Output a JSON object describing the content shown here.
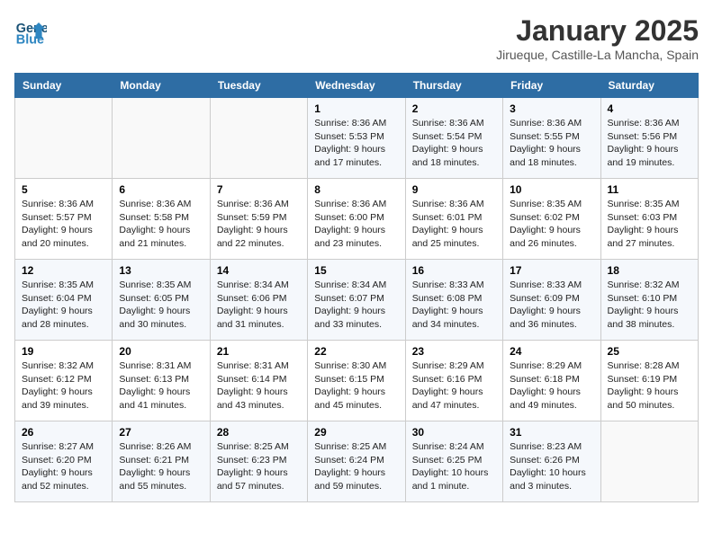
{
  "header": {
    "logo_line1": "General",
    "logo_line2": "Blue",
    "month_title": "January 2025",
    "location": "Jirueque, Castille-La Mancha, Spain"
  },
  "weekdays": [
    "Sunday",
    "Monday",
    "Tuesday",
    "Wednesday",
    "Thursday",
    "Friday",
    "Saturday"
  ],
  "weeks": [
    [
      {
        "day": "",
        "sunrise": "",
        "sunset": "",
        "daylight": ""
      },
      {
        "day": "",
        "sunrise": "",
        "sunset": "",
        "daylight": ""
      },
      {
        "day": "",
        "sunrise": "",
        "sunset": "",
        "daylight": ""
      },
      {
        "day": "1",
        "sunrise": "Sunrise: 8:36 AM",
        "sunset": "Sunset: 5:53 PM",
        "daylight": "Daylight: 9 hours and 17 minutes."
      },
      {
        "day": "2",
        "sunrise": "Sunrise: 8:36 AM",
        "sunset": "Sunset: 5:54 PM",
        "daylight": "Daylight: 9 hours and 18 minutes."
      },
      {
        "day": "3",
        "sunrise": "Sunrise: 8:36 AM",
        "sunset": "Sunset: 5:55 PM",
        "daylight": "Daylight: 9 hours and 18 minutes."
      },
      {
        "day": "4",
        "sunrise": "Sunrise: 8:36 AM",
        "sunset": "Sunset: 5:56 PM",
        "daylight": "Daylight: 9 hours and 19 minutes."
      }
    ],
    [
      {
        "day": "5",
        "sunrise": "Sunrise: 8:36 AM",
        "sunset": "Sunset: 5:57 PM",
        "daylight": "Daylight: 9 hours and 20 minutes."
      },
      {
        "day": "6",
        "sunrise": "Sunrise: 8:36 AM",
        "sunset": "Sunset: 5:58 PM",
        "daylight": "Daylight: 9 hours and 21 minutes."
      },
      {
        "day": "7",
        "sunrise": "Sunrise: 8:36 AM",
        "sunset": "Sunset: 5:59 PM",
        "daylight": "Daylight: 9 hours and 22 minutes."
      },
      {
        "day": "8",
        "sunrise": "Sunrise: 8:36 AM",
        "sunset": "Sunset: 6:00 PM",
        "daylight": "Daylight: 9 hours and 23 minutes."
      },
      {
        "day": "9",
        "sunrise": "Sunrise: 8:36 AM",
        "sunset": "Sunset: 6:01 PM",
        "daylight": "Daylight: 9 hours and 25 minutes."
      },
      {
        "day": "10",
        "sunrise": "Sunrise: 8:35 AM",
        "sunset": "Sunset: 6:02 PM",
        "daylight": "Daylight: 9 hours and 26 minutes."
      },
      {
        "day": "11",
        "sunrise": "Sunrise: 8:35 AM",
        "sunset": "Sunset: 6:03 PM",
        "daylight": "Daylight: 9 hours and 27 minutes."
      }
    ],
    [
      {
        "day": "12",
        "sunrise": "Sunrise: 8:35 AM",
        "sunset": "Sunset: 6:04 PM",
        "daylight": "Daylight: 9 hours and 28 minutes."
      },
      {
        "day": "13",
        "sunrise": "Sunrise: 8:35 AM",
        "sunset": "Sunset: 6:05 PM",
        "daylight": "Daylight: 9 hours and 30 minutes."
      },
      {
        "day": "14",
        "sunrise": "Sunrise: 8:34 AM",
        "sunset": "Sunset: 6:06 PM",
        "daylight": "Daylight: 9 hours and 31 minutes."
      },
      {
        "day": "15",
        "sunrise": "Sunrise: 8:34 AM",
        "sunset": "Sunset: 6:07 PM",
        "daylight": "Daylight: 9 hours and 33 minutes."
      },
      {
        "day": "16",
        "sunrise": "Sunrise: 8:33 AM",
        "sunset": "Sunset: 6:08 PM",
        "daylight": "Daylight: 9 hours and 34 minutes."
      },
      {
        "day": "17",
        "sunrise": "Sunrise: 8:33 AM",
        "sunset": "Sunset: 6:09 PM",
        "daylight": "Daylight: 9 hours and 36 minutes."
      },
      {
        "day": "18",
        "sunrise": "Sunrise: 8:32 AM",
        "sunset": "Sunset: 6:10 PM",
        "daylight": "Daylight: 9 hours and 38 minutes."
      }
    ],
    [
      {
        "day": "19",
        "sunrise": "Sunrise: 8:32 AM",
        "sunset": "Sunset: 6:12 PM",
        "daylight": "Daylight: 9 hours and 39 minutes."
      },
      {
        "day": "20",
        "sunrise": "Sunrise: 8:31 AM",
        "sunset": "Sunset: 6:13 PM",
        "daylight": "Daylight: 9 hours and 41 minutes."
      },
      {
        "day": "21",
        "sunrise": "Sunrise: 8:31 AM",
        "sunset": "Sunset: 6:14 PM",
        "daylight": "Daylight: 9 hours and 43 minutes."
      },
      {
        "day": "22",
        "sunrise": "Sunrise: 8:30 AM",
        "sunset": "Sunset: 6:15 PM",
        "daylight": "Daylight: 9 hours and 45 minutes."
      },
      {
        "day": "23",
        "sunrise": "Sunrise: 8:29 AM",
        "sunset": "Sunset: 6:16 PM",
        "daylight": "Daylight: 9 hours and 47 minutes."
      },
      {
        "day": "24",
        "sunrise": "Sunrise: 8:29 AM",
        "sunset": "Sunset: 6:18 PM",
        "daylight": "Daylight: 9 hours and 49 minutes."
      },
      {
        "day": "25",
        "sunrise": "Sunrise: 8:28 AM",
        "sunset": "Sunset: 6:19 PM",
        "daylight": "Daylight: 9 hours and 50 minutes."
      }
    ],
    [
      {
        "day": "26",
        "sunrise": "Sunrise: 8:27 AM",
        "sunset": "Sunset: 6:20 PM",
        "daylight": "Daylight: 9 hours and 52 minutes."
      },
      {
        "day": "27",
        "sunrise": "Sunrise: 8:26 AM",
        "sunset": "Sunset: 6:21 PM",
        "daylight": "Daylight: 9 hours and 55 minutes."
      },
      {
        "day": "28",
        "sunrise": "Sunrise: 8:25 AM",
        "sunset": "Sunset: 6:23 PM",
        "daylight": "Daylight: 9 hours and 57 minutes."
      },
      {
        "day": "29",
        "sunrise": "Sunrise: 8:25 AM",
        "sunset": "Sunset: 6:24 PM",
        "daylight": "Daylight: 9 hours and 59 minutes."
      },
      {
        "day": "30",
        "sunrise": "Sunrise: 8:24 AM",
        "sunset": "Sunset: 6:25 PM",
        "daylight": "Daylight: 10 hours and 1 minute."
      },
      {
        "day": "31",
        "sunrise": "Sunrise: 8:23 AM",
        "sunset": "Sunset: 6:26 PM",
        "daylight": "Daylight: 10 hours and 3 minutes."
      },
      {
        "day": "",
        "sunrise": "",
        "sunset": "",
        "daylight": ""
      }
    ]
  ]
}
